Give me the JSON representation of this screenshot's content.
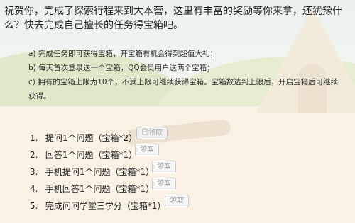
{
  "intro_text": "祝贺你，完成了探索行程来到大本营，这里有丰富的奖励等你来拿，还犹豫什么？快去完成自己擅长的任务得宝箱吧。",
  "rules": [
    "a) 完成任务即可获得宝箱，开宝箱有机会得到超值大礼；",
    "b) 每天首次登录送一个宝箱，QQ会员用户送两个宝箱；",
    "c) 拥有的宝箱上限为10个，不满上限可继续获得宝箱。宝箱数达到上限后，开启宝箱后可继续获得。"
  ],
  "tasks": [
    {
      "num": "1.",
      "text": "提问1个问题（宝箱*2）",
      "button": "已领取"
    },
    {
      "num": "2.",
      "text": "回答1个问题（宝箱*1）",
      "button": "领取"
    },
    {
      "num": "3.",
      "text": "手机提问1个问题（宝箱*1）",
      "button": "领取"
    },
    {
      "num": "4.",
      "text": "手机回答1个问题（宝箱*1）",
      "button": "领取"
    },
    {
      "num": "5.",
      "text": "完成问问学堂三学分（宝箱*1）",
      "button": "领取"
    }
  ]
}
